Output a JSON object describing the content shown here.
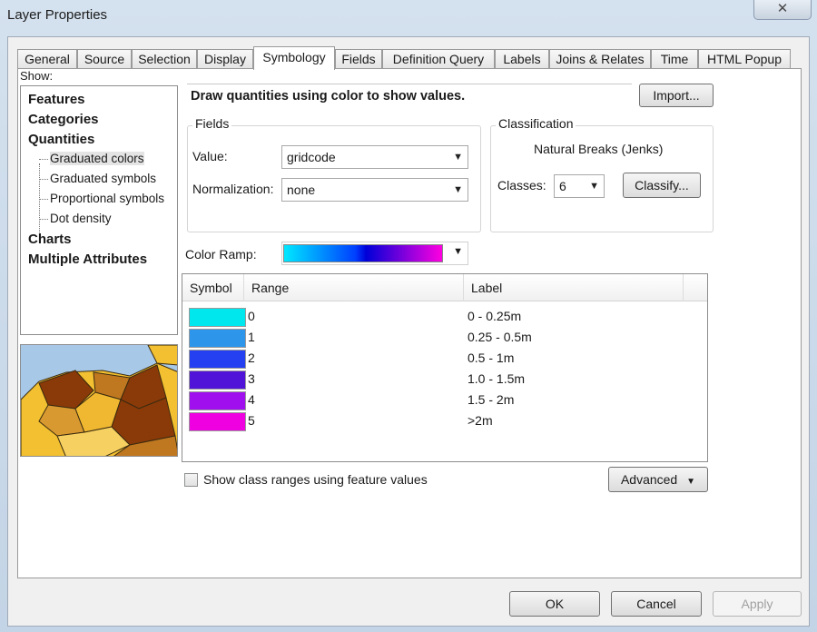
{
  "window": {
    "title": "Layer Properties",
    "close_glyph": "✕"
  },
  "tabs": [
    {
      "label": "General"
    },
    {
      "label": "Source"
    },
    {
      "label": "Selection"
    },
    {
      "label": "Display"
    },
    {
      "label": "Symbology"
    },
    {
      "label": "Fields"
    },
    {
      "label": "Definition Query"
    },
    {
      "label": "Labels"
    },
    {
      "label": "Joins & Relates"
    },
    {
      "label": "Time"
    },
    {
      "label": "HTML Popup"
    }
  ],
  "active_tab": "Symbology",
  "show": {
    "label": "Show:",
    "items": {
      "features": "Features",
      "categories": "Categories",
      "quantities": "Quantities",
      "graduated_colors": "Graduated colors",
      "graduated_symbols": "Graduated symbols",
      "proportional_symbols": "Proportional symbols",
      "dot_density": "Dot density",
      "charts": "Charts",
      "multiple_attributes": "Multiple Attributes"
    },
    "selected": "Graduated colors"
  },
  "description": "Draw quantities using color to show values.",
  "import_label": "Import...",
  "fields": {
    "title": "Fields",
    "value_label": "Value:",
    "value": "gridcode",
    "normalization_label": "Normalization:",
    "normalization": "none"
  },
  "classification": {
    "title": "Classification",
    "method": "Natural Breaks (Jenks)",
    "classes_label": "Classes:",
    "classes": "6",
    "classify_label": "Classify..."
  },
  "color_ramp": {
    "label": "Color Ramp:"
  },
  "table": {
    "headers": {
      "symbol": "Symbol",
      "range": "Range",
      "label": "Label"
    },
    "rows": [
      {
        "color": "#00e8ee",
        "range": "0",
        "label": "0 - 0.25m"
      },
      {
        "color": "#2e96ea",
        "range": "1",
        "label": "0.25 - 0.5m"
      },
      {
        "color": "#2440f0",
        "range": "2",
        "label": "0.5 - 1m"
      },
      {
        "color": "#5014d8",
        "range": "3",
        "label": "1.0 - 1.5m"
      },
      {
        "color": "#a010ee",
        "range": "4",
        "label": "1.5 - 2m"
      },
      {
        "color": "#ee00e0",
        "range": "5",
        "label": ">2m"
      }
    ]
  },
  "show_class_ranges_label": "Show class ranges using feature values",
  "advanced_label": "Advanced",
  "buttons": {
    "ok": "OK",
    "cancel": "Cancel",
    "apply": "Apply"
  }
}
